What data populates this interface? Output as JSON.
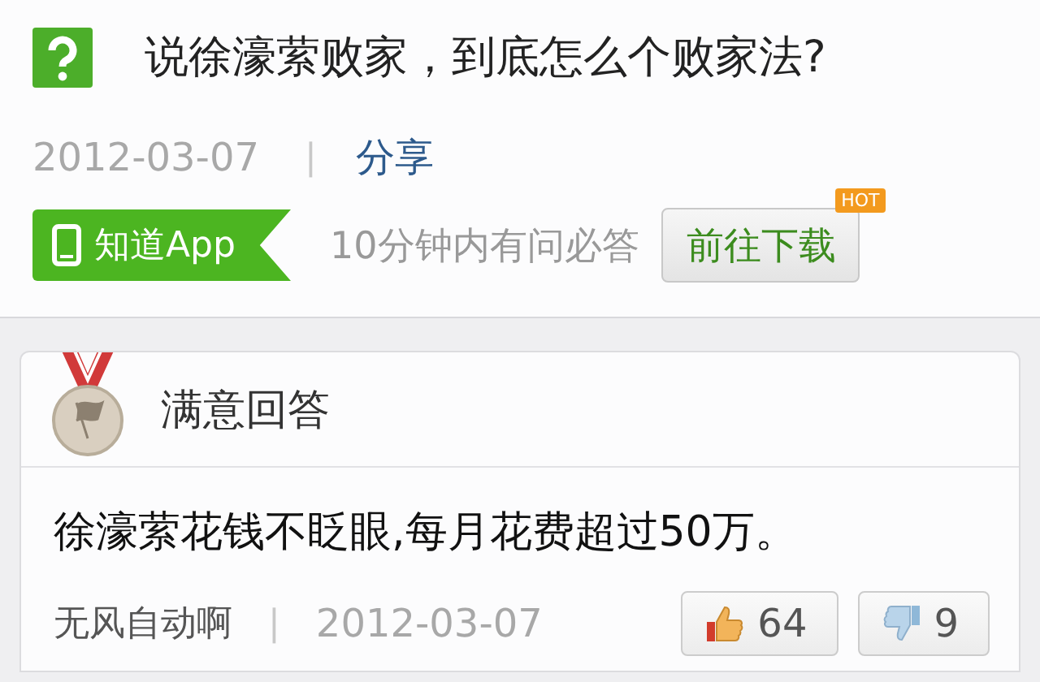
{
  "question": {
    "title": "说徐濠萦败家，到底怎么个败家法?",
    "date": "2012-03-07",
    "separator": "|",
    "share": "分享"
  },
  "app_banner": {
    "badge": "知道App",
    "slogan": "10分钟内有问必答",
    "button": "前往下载",
    "hot": "HOT"
  },
  "answer": {
    "heading": "满意回答",
    "text": "徐濠萦花钱不眨眼,每月花费超过50万。",
    "author": "无风自动啊",
    "separator": "|",
    "date": "2012-03-07",
    "likes": "64",
    "dislikes": "9"
  }
}
